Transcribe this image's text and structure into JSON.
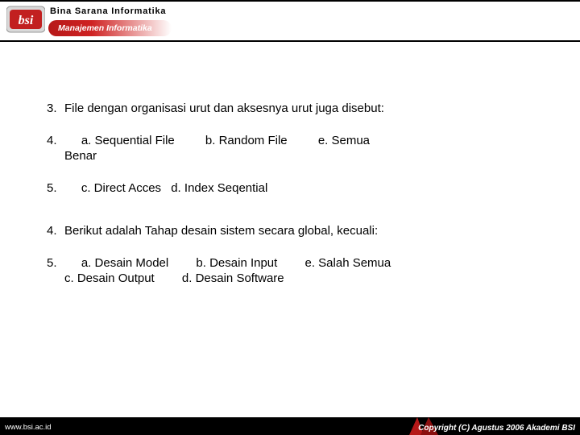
{
  "header": {
    "org_name": "Bina Sarana Informatika",
    "tagline": "Manajemen Informatika"
  },
  "body": {
    "q3": {
      "num": "3.",
      "text": "File dengan organisasi urut dan aksesnya urut juga disebut:"
    },
    "q3_line4": {
      "num": "4.",
      "a": "a. Sequential File",
      "b": "b. Random File",
      "e": "e. Semua",
      "tail": "Benar"
    },
    "q3_line5": {
      "num": "5.",
      "c": "c. Direct Acces",
      "d": "d. Index Seqential"
    },
    "q4": {
      "num": "4.",
      "text": "Berikut adalah Tahap desain sistem secara global, kecuali:"
    },
    "q4_line5": {
      "num": "5.",
      "a": "a. Desain Model",
      "b": "b. Desain Input",
      "e": "e. Salah Semua",
      "c": "c. Desain Output",
      "d": "d. Desain Software"
    }
  },
  "footer": {
    "url": "www.bsi.ac.id",
    "copyright": "Copyright (C) Agustus 2006 Akademi BSI"
  }
}
